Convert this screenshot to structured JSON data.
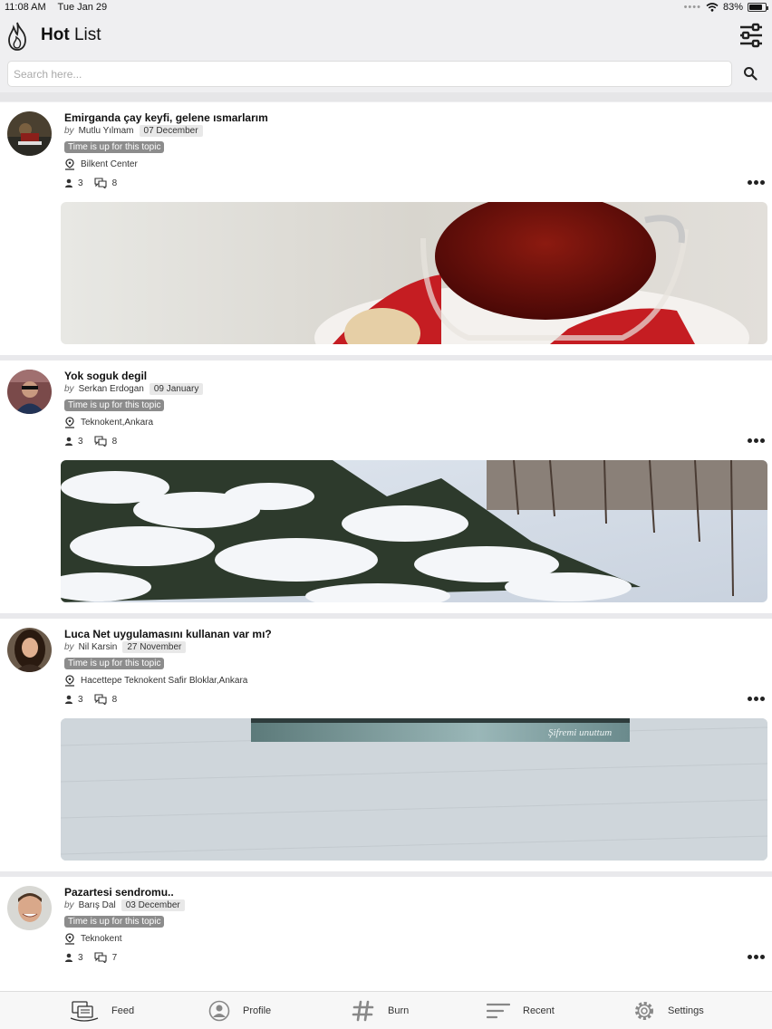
{
  "status_bar": {
    "time": "11:08 AM",
    "date": "Tue Jan 29",
    "battery": "83%",
    "battery_level": 0.83
  },
  "header": {
    "title_bold": "Hot",
    "title_rest": "List"
  },
  "search": {
    "placeholder": "Search here..."
  },
  "posts": [
    {
      "title": "Emirganda çay keyfi, gelene ısmarlarım",
      "by": "by",
      "author": "Mutlu Yılmam",
      "date": "07 December",
      "badge": "Time is up for this topic",
      "location": "Bilkent Center",
      "people": "3",
      "comments": "8"
    },
    {
      "title": "Yok soguk degil",
      "by": "by",
      "author": "Serkan Erdogan",
      "date": "09 January",
      "badge": "Time is up for this topic",
      "location": "Teknokent,Ankara",
      "people": "3",
      "comments": "8"
    },
    {
      "title": "Luca Net uygulamasını kullanan var mı?",
      "by": "by",
      "author": "Nil Karsin",
      "date": "27 November",
      "badge": "Time is up for this topic",
      "location": "Hacettepe Teknokent Safir Bloklar,Ankara",
      "people": "3",
      "comments": "8",
      "image_text": "Şifremi unuttum"
    },
    {
      "title": "Pazartesi sendromu..",
      "by": "by",
      "author": "Barış Dal",
      "date": "03 December",
      "badge": "Time is up for this topic",
      "location": "Teknokent",
      "people": "3",
      "comments": "7"
    }
  ],
  "nav": {
    "feed": "Feed",
    "profile": "Profile",
    "burn": "Burn",
    "recent": "Recent",
    "settings": "Settings"
  }
}
